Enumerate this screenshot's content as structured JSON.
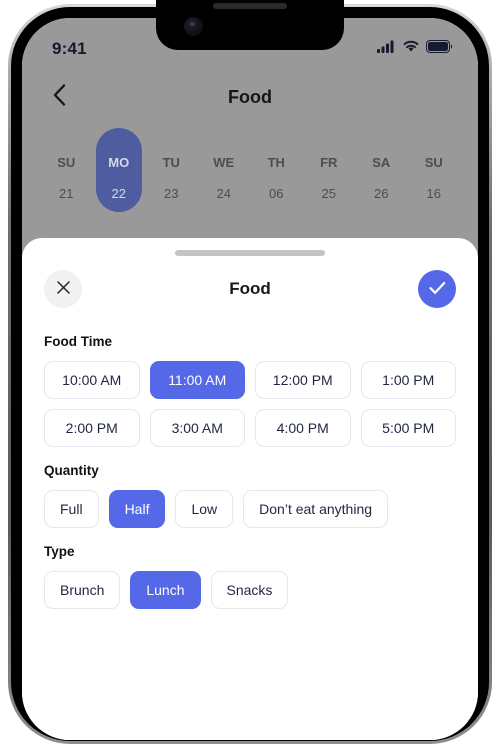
{
  "status_bar": {
    "time": "9:41",
    "icons": [
      "cellular-signal-icon",
      "wifi-icon",
      "battery-icon"
    ]
  },
  "nav": {
    "back_icon": "chevron-left-icon",
    "title": "Food"
  },
  "week_strip": {
    "days": [
      {
        "dow": "SU",
        "num": "21",
        "selected": false
      },
      {
        "dow": "MO",
        "num": "22",
        "selected": true
      },
      {
        "dow": "TU",
        "num": "23",
        "selected": false
      },
      {
        "dow": "WE",
        "num": "24",
        "selected": false
      },
      {
        "dow": "TH",
        "num": "06",
        "selected": false
      },
      {
        "dow": "FR",
        "num": "25",
        "selected": false
      },
      {
        "dow": "SA",
        "num": "26",
        "selected": false
      },
      {
        "dow": "SU",
        "num": "16",
        "selected": false
      }
    ]
  },
  "sheet": {
    "title": "Food",
    "close_icon": "close-icon",
    "confirm_icon": "check-icon",
    "sections": [
      {
        "label": "Food Time",
        "options": [
          {
            "label": "10:00 AM",
            "selected": false
          },
          {
            "label": "11:00 AM",
            "selected": true
          },
          {
            "label": "12:00 PM",
            "selected": false
          },
          {
            "label": "1:00 PM",
            "selected": false
          },
          {
            "label": "2:00 PM",
            "selected": false
          },
          {
            "label": "3:00 AM",
            "selected": false
          },
          {
            "label": "4:00 PM",
            "selected": false
          },
          {
            "label": "5:00 PM",
            "selected": false
          }
        ]
      },
      {
        "label": "Quantity",
        "options": [
          {
            "label": "Full",
            "selected": false
          },
          {
            "label": "Half",
            "selected": true
          },
          {
            "label": "Low",
            "selected": false
          },
          {
            "label": "Don’t eat anything",
            "selected": false
          }
        ]
      },
      {
        "label": "Type",
        "options": [
          {
            "label": "Brunch",
            "selected": false
          },
          {
            "label": "Lunch",
            "selected": true
          },
          {
            "label": "Snacks",
            "selected": false
          }
        ]
      }
    ]
  },
  "colors": {
    "accent": "#5468e8",
    "accent_dimmed": "#4f5ca0",
    "sheet_bg": "#ffffff",
    "backdrop": "#999999",
    "chip_border": "#e6e7ec",
    "chip_text": "#1f2740"
  }
}
